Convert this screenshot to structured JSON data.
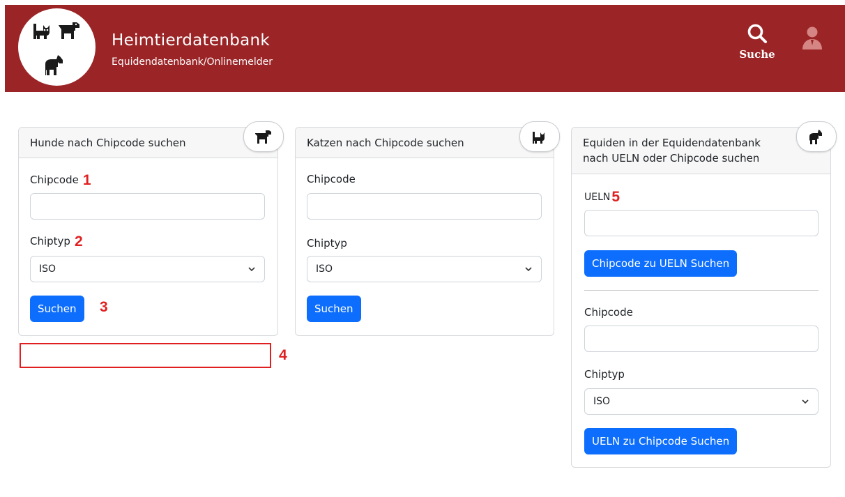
{
  "header": {
    "title": "Heimtierdatenbank",
    "subtitle": "Equidendatenbank/Onlinemelder",
    "search_label": "Suche",
    "brand_color": "#9b2426",
    "search_icon": "search-icon",
    "user_icon": "user-icon"
  },
  "dogs_card": {
    "title": "Hunde nach Chipcode suchen",
    "icon": "dog-icon",
    "chipcode_label": "Chipcode",
    "chipcode_value": "",
    "chiptyp_label": "Chiptyp",
    "chiptyp_selected": "ISO",
    "search_button": "Suchen"
  },
  "cats_card": {
    "title": "Katzen nach Chipcode suchen",
    "icon": "cat-icon",
    "chipcode_label": "Chipcode",
    "chipcode_value": "",
    "chiptyp_label": "Chiptyp",
    "chiptyp_selected": "ISO",
    "search_button": "Suchen"
  },
  "equids_card": {
    "title_line1": "Equiden in der Equidendatenbank",
    "title_line2": "nach UELN oder Chipcode suchen",
    "icon": "horse-icon",
    "ueln_label": "UELN",
    "ueln_value": "",
    "ueln_button": "Chipcode zu UELN Suchen",
    "chipcode_label": "Chipcode",
    "chipcode_value": "",
    "chiptyp_label": "Chiptyp",
    "chiptyp_selected": "ISO",
    "chip_button": "UELN zu Chipcode Suchen"
  },
  "annotations": {
    "n1": "1",
    "n2": "2",
    "n3": "3",
    "n4": "4",
    "n5": "5",
    "color": "#e02020"
  },
  "accent_color": "#0d6efd"
}
